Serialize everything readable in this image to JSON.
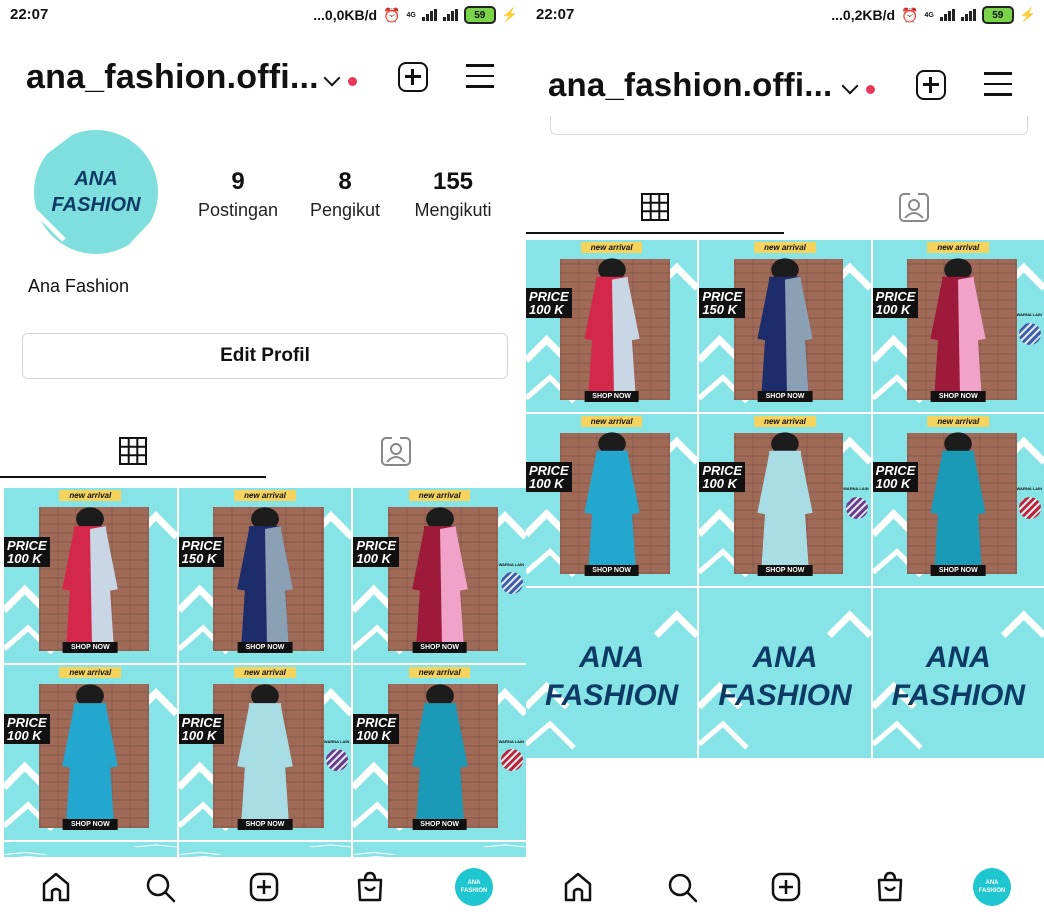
{
  "left": {
    "status": {
      "time": "22:07",
      "net": "...0,0KB/d",
      "net_type": "4G",
      "battery": "59"
    },
    "username": "ana_fashion.offi...",
    "avatar_text": [
      "ANA",
      "FASHION"
    ],
    "stats": [
      {
        "num": "9",
        "label": "Postingan"
      },
      {
        "num": "8",
        "label": "Pengikut"
      },
      {
        "num": "155",
        "label": "Mengikuti"
      }
    ],
    "full_name": "Ana Fashion",
    "edit_button": "Edit Profil"
  },
  "right": {
    "status": {
      "time": "22:07",
      "net": "...0,2KB/d",
      "net_type": "4G",
      "battery": "59"
    },
    "username": "ana_fashion.offi..."
  },
  "post_common": {
    "new_arrival": "new arrival",
    "shop_now": "SHOP NOW",
    "warna_lain": "WARNA LAIN"
  },
  "posts": [
    {
      "price": [
        "PRICE",
        "100 K"
      ],
      "dress": "#d4284a",
      "dress2": "#c9d6e6",
      "swatch": ""
    },
    {
      "price": [
        "PRICE",
        "150 K"
      ],
      "dress": "#1d2d6b",
      "dress2": "#8aa0b5",
      "swatch": ""
    },
    {
      "price": [
        "PRICE",
        "100 K"
      ],
      "dress": "#9e1a3a",
      "dress2": "#f0a2c8",
      "swatch": "#3d5fa8"
    },
    {
      "price": [
        "PRICE",
        "100 K"
      ],
      "dress": "#23a7cf",
      "dress2": "#23a7cf",
      "swatch": ""
    },
    {
      "price": [
        "PRICE",
        "100 K"
      ],
      "dress": "#a9dde6",
      "dress2": "#a9dde6",
      "swatch": "#6a3c8c"
    },
    {
      "price": [
        "PRICE",
        "100 K"
      ],
      "dress": "#1b9ab7",
      "dress2": "#1b9ab7",
      "swatch": "#b8283c"
    }
  ],
  "brand_post": [
    "ANA",
    "FASHION"
  ],
  "nav_avatar_text": [
    "ANA",
    "FASHION"
  ],
  "colors": {
    "accent_dot": "#e8385a",
    "avatar_bg": "#7fdede",
    "post_bg": "#86e3e6",
    "brand_text": "#0d3b66"
  },
  "icons": [
    "home-icon",
    "search-icon",
    "add-post-icon",
    "shop-bag-icon",
    "profile-avatar",
    "grid-icon",
    "tagged-icon",
    "menu-icon",
    "new-post-icon",
    "chevron-down-icon"
  ]
}
